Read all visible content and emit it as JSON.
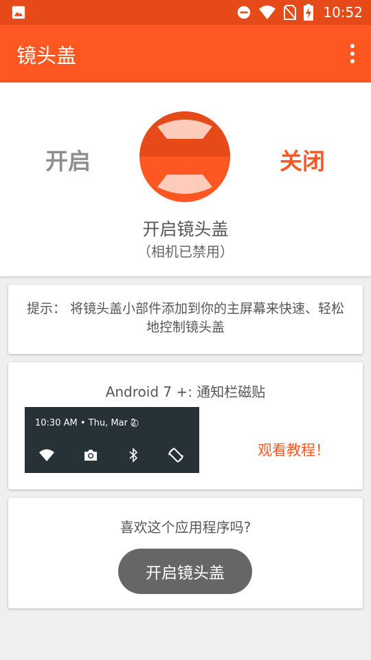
{
  "status_bar": {
    "time": "10:52",
    "icons": [
      "image-icon",
      "do-not-disturb-icon",
      "wifi-icon",
      "no-sim-icon",
      "battery-charging-icon"
    ]
  },
  "app_bar": {
    "title": "镜头盖",
    "menu_icon": "more-vert-icon"
  },
  "toggle": {
    "on_label": "开启",
    "off_label": "关闭",
    "status_text": "开启镜头盖",
    "status_subtext": "（相机已禁用）",
    "lens_icon": "lens-cover-icon"
  },
  "tip": {
    "text": "提示： 将镜头盖小部件添加到你的主屏幕来快速、轻松地控制镜头盖"
  },
  "quick_tile": {
    "title": "Android 7 +: 通知栏磁贴",
    "preview": {
      "time_text": "10:30 AM • Thu, Mar 2",
      "icons": [
        "wifi-icon",
        "camera-icon",
        "bluetooth-icon",
        "auto-rotate-icon"
      ]
    },
    "tutorial_link": "观看教程！"
  },
  "rate": {
    "question": "喜欢这个应用程序吗?",
    "button_label": "开启镜头盖"
  },
  "colors": {
    "status_bar": "#e64a19",
    "app_bar": "#ff5722",
    "accent": "#ff5722",
    "button": "#666666"
  }
}
